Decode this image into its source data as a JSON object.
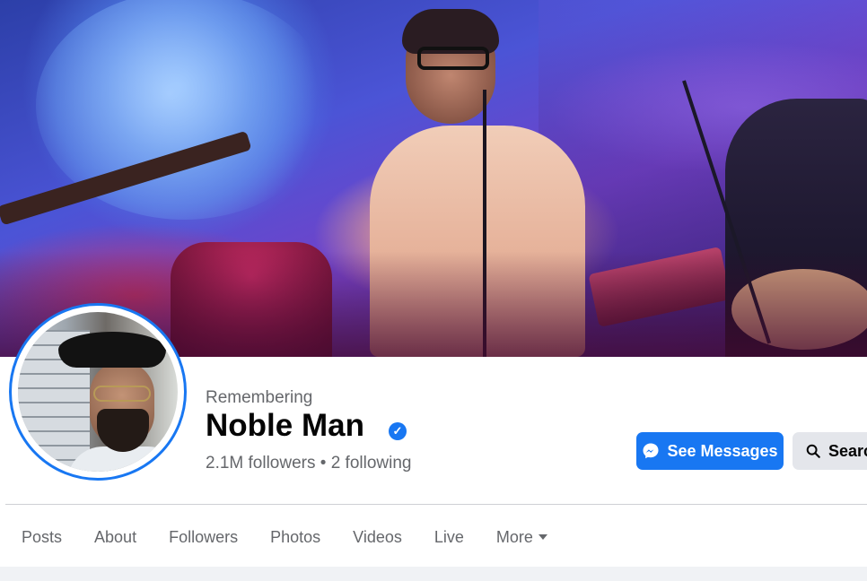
{
  "profile": {
    "status_label": "Remembering",
    "name": "Noble Man",
    "verified_badge_icon": "verified-check-icon",
    "followers_text": "2.1M followers • 2 following"
  },
  "actions": {
    "primary": {
      "label": "See Messages",
      "icon": "messenger-icon"
    },
    "secondary": {
      "label": "Search",
      "icon": "search-icon"
    }
  },
  "tabs": [
    {
      "label": "Posts"
    },
    {
      "label": "About"
    },
    {
      "label": "Followers"
    },
    {
      "label": "Photos"
    },
    {
      "label": "Videos"
    },
    {
      "label": "Live"
    },
    {
      "label": "More",
      "icon": "caret-down-icon"
    }
  ],
  "colors": {
    "accent": "#1877f2",
    "secondary_button_bg": "#e4e6eb",
    "muted_text": "#65676b",
    "primary_text": "#050505"
  }
}
